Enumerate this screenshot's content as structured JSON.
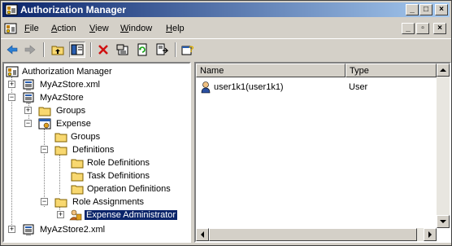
{
  "window": {
    "title": "Authorization Manager"
  },
  "menu": {
    "items": [
      {
        "label": "File",
        "accel": "F",
        "rest": "ile"
      },
      {
        "label": "Action",
        "accel": "A",
        "rest": "ction"
      },
      {
        "label": "View",
        "accel": "V",
        "rest": "iew"
      },
      {
        "label": "Window",
        "accel": "W",
        "rest": "indow"
      },
      {
        "label": "Help",
        "accel": "H",
        "rest": "elp"
      }
    ]
  },
  "toolbar": {
    "icons": [
      "back-icon",
      "forward-icon",
      "up-folder-icon",
      "show-hide-tree-icon",
      "delete-icon",
      "properties-icon",
      "refresh-icon",
      "export-list-icon",
      "help-icon"
    ]
  },
  "tree": {
    "root": "Authorization Manager",
    "store1": "MyAzStore.xml",
    "store_open": "MyAzStore",
    "groups": "Groups",
    "application": "Expense",
    "app_groups": "Groups",
    "definitions": "Definitions",
    "role_defs": "Role Definitions",
    "task_defs": "Task Definitions",
    "op_defs": "Operation Definitions",
    "role_assignments": "Role Assignments",
    "expense_admin": "Expense Administrator",
    "store2": "MyAzStore2.xml"
  },
  "list": {
    "columns": [
      "Name",
      "Type"
    ],
    "rows": [
      {
        "name": "user1k1(user1k1)",
        "type": "User"
      }
    ]
  }
}
